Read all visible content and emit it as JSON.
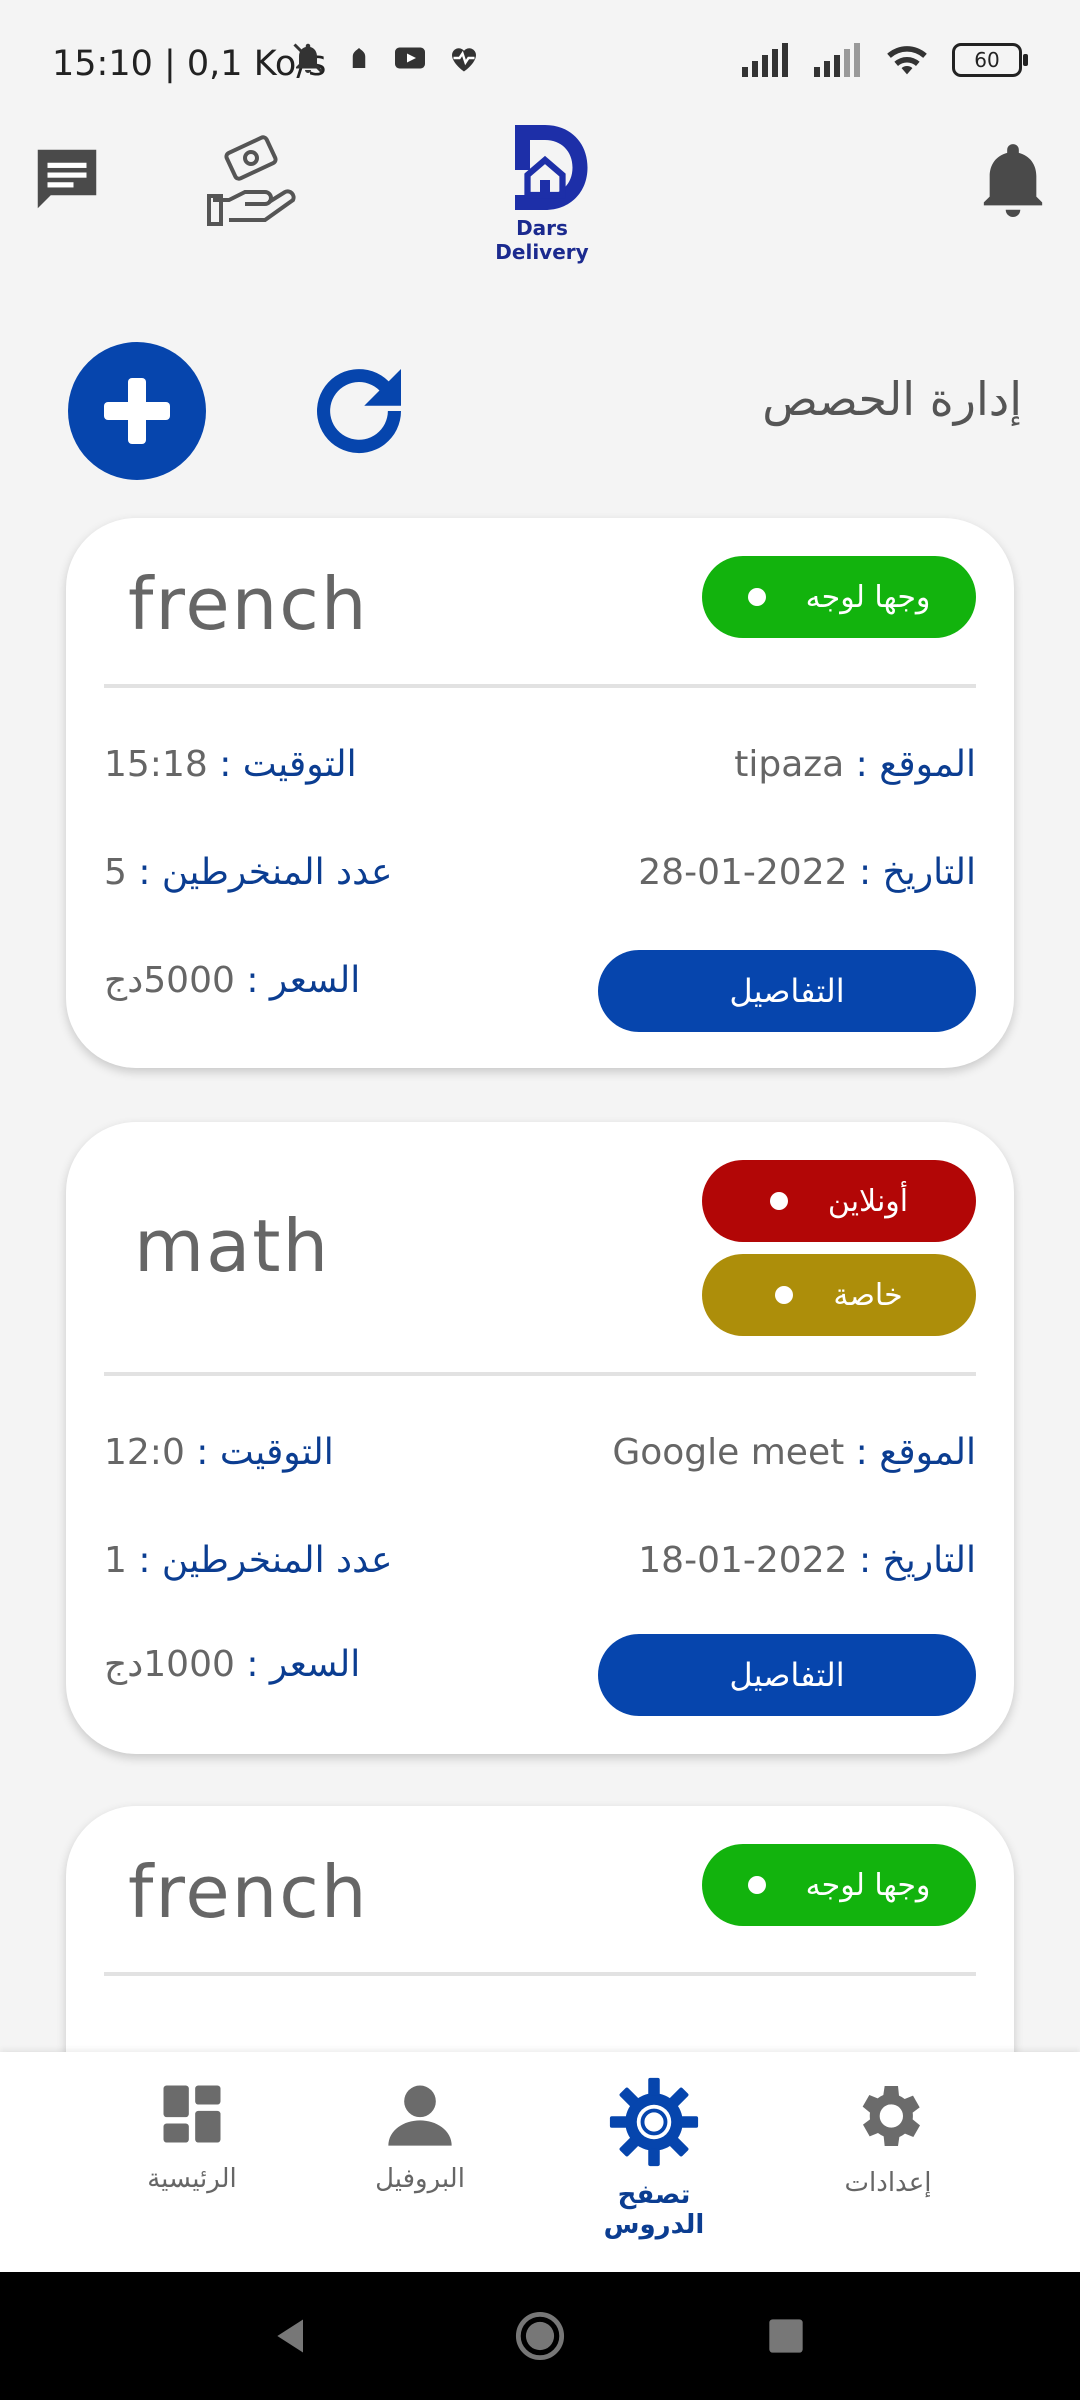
{
  "status": {
    "time": "15:10 | 0,1 Ko/s",
    "battery": "60"
  },
  "app": {
    "logo_text": "Dars Delivery",
    "section_title": "إدارة الحصص"
  },
  "cards": [
    {
      "title": "french",
      "tags": [
        {
          "label": "وجها لوجه",
          "color": "#12b30d"
        }
      ],
      "time_label": "التوقيت :",
      "time_value": "15:18",
      "location_label": "الموقع :",
      "location_value": "tipaza",
      "enrolled_label": "عدد المنخرطين :",
      "enrolled_value": "5",
      "date_label": "التاريخ :",
      "date_value": "2022-01-28",
      "price_label": "السعر :",
      "price_value": "5000دج",
      "details_label": "التفاصيل"
    },
    {
      "title": "math",
      "tags": [
        {
          "label": "أونلاين",
          "color": "#b20606"
        },
        {
          "label": "خاصة",
          "color": "#ad8e0a"
        }
      ],
      "time_label": "التوقيت :",
      "time_value": "12:0",
      "location_label": "الموقع :",
      "location_value": "Google meet",
      "enrolled_label": "عدد المنخرطين :",
      "enrolled_value": "1",
      "date_label": "التاريخ :",
      "date_value": "2022-01-18",
      "price_label": "السعر :",
      "price_value": "1000دج",
      "details_label": "التفاصيل"
    },
    {
      "title": "french",
      "tags": [
        {
          "label": "وجها لوجه",
          "color": "#12b30d"
        }
      ]
    }
  ],
  "nav": {
    "home": "الرئيسية",
    "profile": "البروفيل",
    "browse": "تصفح الدروس",
    "settings": "إعدادات"
  },
  "colors": {
    "primary": "#0645ad",
    "label_blue": "#0b3d91",
    "online_red": "#b20606",
    "private_gold": "#ad8e0a",
    "face_green": "#12b30d"
  }
}
